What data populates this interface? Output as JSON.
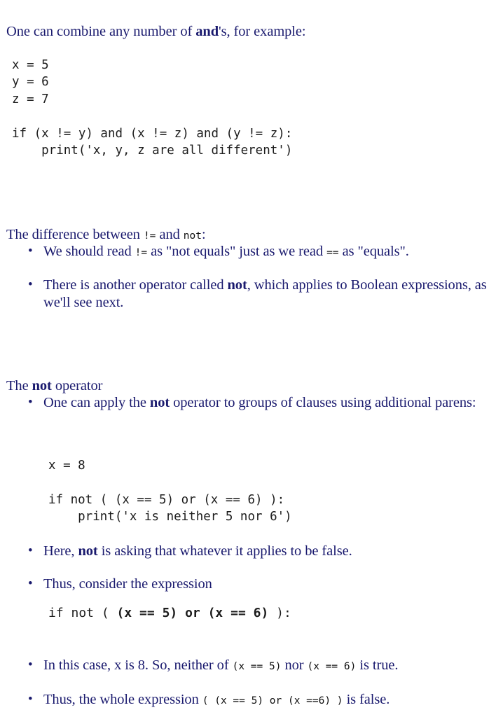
{
  "document": {
    "background_color": "#ffffff",
    "text_color": "#1a1a6e",
    "code_color": "#1c1c1c"
  },
  "lead": {
    "before_bold": "One can combine any number of ",
    "bold": "and",
    "after_bold": "'s, for example:"
  },
  "code_and_example": "x = 5\ny = 6\nz = 7\n\nif (x != y) and (x != z) and (y != z):\n    print('x, y, z are all different')",
  "head_difference": {
    "part1": "The difference between ",
    "code1": "!=",
    "part2": " and ",
    "code2": "not",
    "part3": ":"
  },
  "bullets_difference": [
    {
      "part1": "We should read ",
      "code1": "!=",
      "part2": " as \"not equals\" just as we read ",
      "code2": "==",
      "part3": " as \"equals\"."
    },
    {
      "part1": "There is another operator called ",
      "bold": "not",
      "part2": ", which applies to Boolean expressions, as we'll see next."
    }
  ],
  "head_not": {
    "part1": "The ",
    "bold": "not",
    "part2": " operator"
  },
  "bullets_not_a": [
    {
      "part1": "One can apply the ",
      "bold": "not",
      "part2": " operator to groups of clauses using additional parens:"
    }
  ],
  "code_not_example": "x = 8\n\nif not ( (x == 5) or (x == 6) ):\n    print('x is neither 5 nor 6')",
  "bullets_not_b": [
    {
      "part1": "Here, ",
      "bold": "not",
      "part2": " is asking that whatever it applies to be false."
    },
    {
      "part1": "Thus, consider the expression"
    }
  ],
  "code_expression": {
    "prefix": "if not ( ",
    "bold": "(x == 5) or (x == 6)",
    "suffix": " ):"
  },
  "bullets_not_c": [
    {
      "part1": "In this case, x is 8. So, neither of ",
      "code1": "(x == 5)",
      "part2": " nor ",
      "code2": "(x == 6)",
      "part3": " is true."
    },
    {
      "part1": "Thus, the whole expression ",
      "code1": "( (x == 5) or (x ==6) )",
      "part2": " is false."
    }
  ]
}
